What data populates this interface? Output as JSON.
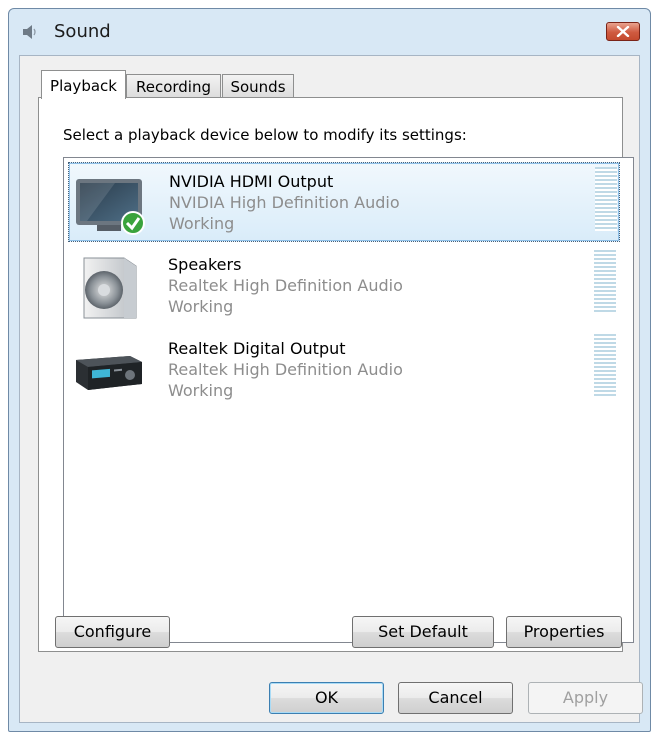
{
  "window": {
    "title": "Sound",
    "title_icon": "speaker-icon",
    "close_icon": "close-icon"
  },
  "tabs": [
    {
      "label": "Playback",
      "active": true
    },
    {
      "label": "Recording",
      "active": false
    },
    {
      "label": "Sounds",
      "active": false
    }
  ],
  "playback": {
    "instruction": "Select a playback device below to modify its settings:",
    "devices": [
      {
        "name": "NVIDIA HDMI Output",
        "driver": "NVIDIA High Definition Audio",
        "status": "Working",
        "icon": "monitor-icon",
        "default": true,
        "selected": true
      },
      {
        "name": "Speakers",
        "driver": "Realtek High Definition Audio",
        "status": "Working",
        "icon": "speaker-device-icon",
        "default": false,
        "selected": false
      },
      {
        "name": "Realtek Digital Output",
        "driver": "Realtek High Definition Audio",
        "status": "Working",
        "icon": "digital-receiver-icon",
        "default": false,
        "selected": false
      }
    ],
    "configure_label": "Configure",
    "set_default_label": "Set Default",
    "properties_label": "Properties"
  },
  "footer": {
    "ok_label": "OK",
    "cancel_label": "Cancel",
    "apply_label": "Apply"
  },
  "colors": {
    "frame": "#d8e8f5",
    "selection": "#d9ecf9",
    "close_button": "#cf5a40",
    "secondary_text": "#8d8d8d",
    "level_meter": "#bfd9e6"
  }
}
